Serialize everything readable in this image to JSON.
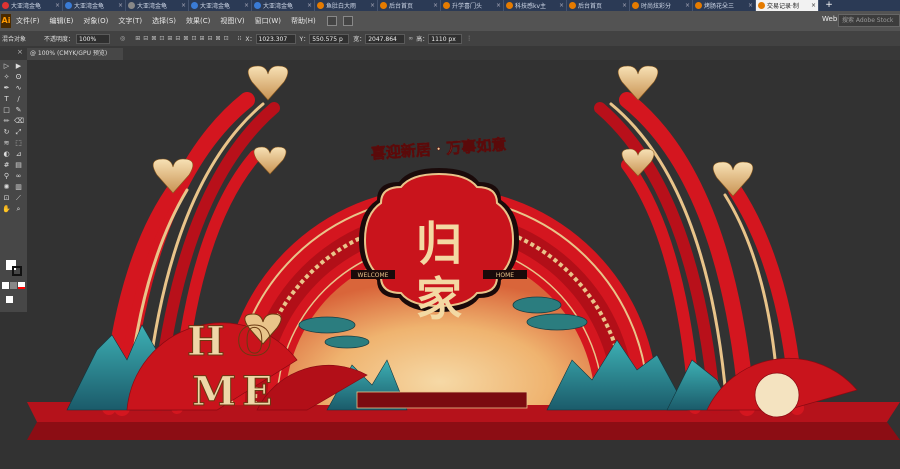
{
  "browser_tabs": [
    {
      "label": "大亚湾金龟",
      "fav": "#d33"
    },
    {
      "label": "大亚湾金龟",
      "fav": "#3a7bd5"
    },
    {
      "label": "大亚湾金龟",
      "fav": "#888"
    },
    {
      "label": "大亚湾金龟",
      "fav": "#3a7bd5"
    },
    {
      "label": "大亚湾金龟",
      "fav": "#3a7bd5"
    },
    {
      "label": "鱼肚白大雨",
      "fav": "#e57b00"
    },
    {
      "label": "后台首页",
      "fav": "#e57b00"
    },
    {
      "label": "升学喜门头",
      "fav": "#e57b00"
    },
    {
      "label": "科技感kv主",
      "fav": "#e57b00"
    },
    {
      "label": "后台首页",
      "fav": "#e57b00"
    },
    {
      "label": "时尚炫彩分",
      "fav": "#e57b00"
    },
    {
      "label": "烤肠花朵三",
      "fav": "#e57b00"
    },
    {
      "label": "交易记录·制",
      "fav": "#e57b00",
      "active": true
    }
  ],
  "new_tab": "+",
  "app_logo": "Ai",
  "menus": [
    "文件(F)",
    "编辑(E)",
    "对象(O)",
    "文字(T)",
    "选择(S)",
    "效果(C)",
    "视图(V)",
    "窗口(W)",
    "帮助(H)"
  ],
  "workspace": "Web",
  "stock_placeholder": "搜索 Adobe Stock",
  "control": {
    "selection": "混合对象",
    "opacity_label": "不透明度：",
    "opacity_value": "100%",
    "x_label": "X：",
    "x_value": "1023.307",
    "y_label": "Y：",
    "y_value": "550.575 p",
    "w_label": "宽：",
    "w_value": "2047.864",
    "h_label": "高：",
    "h_value": "1110 px"
  },
  "document_tab": "@ 100% (CMYK/GPU 预览)",
  "artwork": {
    "main_char_1": "归",
    "main_char_2": "家",
    "top_slogan": "喜迎新居 · 万事如意",
    "side_text_left": "WELCOME",
    "side_text_right": "HOME",
    "home_letters": [
      "H",
      "O",
      "M",
      "E"
    ]
  },
  "colors": {
    "red": "#d4161f",
    "dark_red": "#9e0b12",
    "gold": "#e9c48a",
    "teal": "#2f8f9a",
    "bg": "#323232"
  }
}
